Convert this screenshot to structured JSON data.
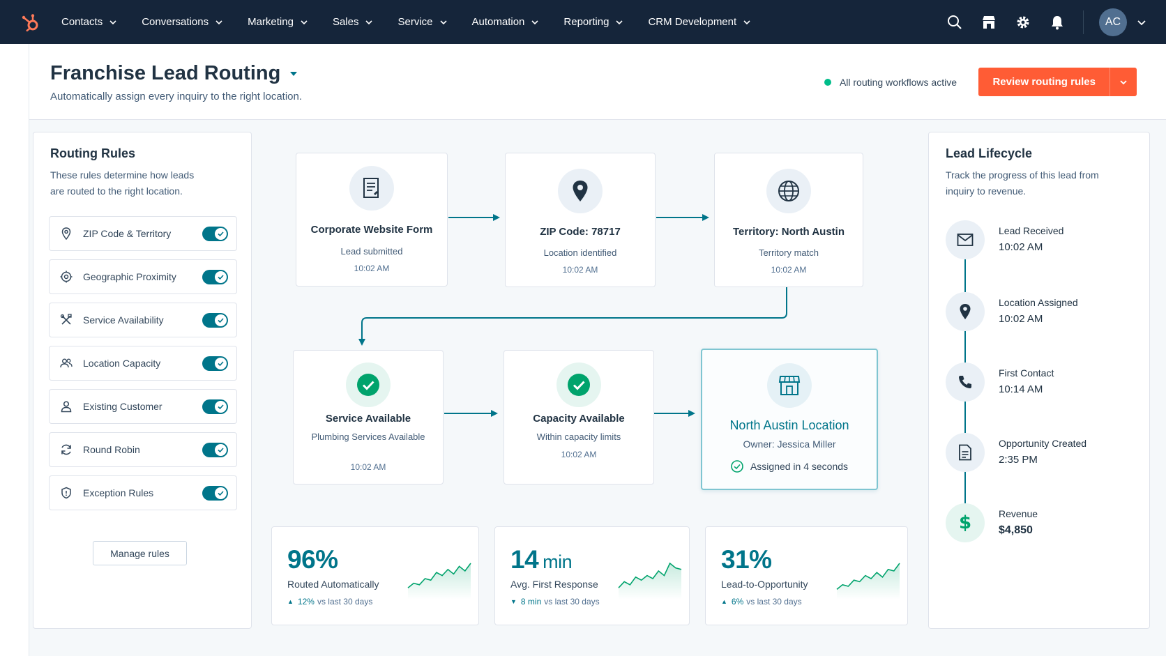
{
  "nav": {
    "items": [
      "Contacts",
      "Conversations",
      "Marketing",
      "Sales",
      "Service",
      "Automation",
      "Reporting",
      "CRM Development"
    ],
    "avatar_initials": "AC"
  },
  "header": {
    "title": "Franchise Lead Routing",
    "subtitle": "Automatically assign every inquiry to the right location.",
    "status": "All routing workflows active",
    "primary_button": "Review routing rules"
  },
  "rules": {
    "title": "Routing Rules",
    "description": "These rules determine how leads are routed to the right location.",
    "items": [
      {
        "label": "ZIP Code & Territory",
        "enabled": true
      },
      {
        "label": "Geographic Proximity",
        "enabled": true
      },
      {
        "label": "Service Availability",
        "enabled": true
      },
      {
        "label": "Location Capacity",
        "enabled": true
      },
      {
        "label": "Existing Customer",
        "enabled": true
      },
      {
        "label": "Round Robin",
        "enabled": true
      },
      {
        "label": "Exception Rules",
        "enabled": true
      }
    ],
    "manage_button": "Manage rules"
  },
  "flow": {
    "step1": {
      "title": "Corporate Website Form",
      "sub": "Lead submitted",
      "time": "10:02 AM"
    },
    "step2": {
      "title": "ZIP Code: 78717",
      "sub": "Location identified",
      "time": "10:02 AM"
    },
    "step3": {
      "title": "Territory: North Austin",
      "sub": "Territory match",
      "time": "10:02 AM"
    },
    "step4": {
      "title": "Service Available",
      "sub": "Plumbing Services Available",
      "time": "10:02 AM"
    },
    "step5": {
      "title": "Capacity Available",
      "sub": "Within capacity limits",
      "time": "10:02 AM"
    },
    "result": {
      "title": "North Austin Location",
      "owner": "Owner: Jessica Miller",
      "assigned": "Assigned in 4 seconds"
    }
  },
  "metrics": [
    {
      "value": "96%",
      "unit": "",
      "label": "Routed Automatically",
      "delta": "12%",
      "delta_suffix": "vs last 30 days",
      "direction": "up",
      "trend": [
        0.2,
        0.35,
        0.3,
        0.5,
        0.45,
        0.7,
        0.6,
        0.8,
        0.65,
        0.9,
        0.75,
        1.0
      ]
    },
    {
      "value": "14",
      "unit": "min",
      "label": "Avg. First Response",
      "delta": "8 min",
      "delta_suffix": "vs last 30 days",
      "direction": "down",
      "trend": [
        0.2,
        0.4,
        0.3,
        0.55,
        0.45,
        0.6,
        0.5,
        0.75,
        0.6,
        1.0,
        0.85,
        0.8
      ]
    },
    {
      "value": "31%",
      "unit": "",
      "label": "Lead-to-Opportunity",
      "delta": "6%",
      "delta_suffix": "vs last 30 days",
      "direction": "up",
      "trend": [
        0.15,
        0.3,
        0.25,
        0.45,
        0.4,
        0.6,
        0.5,
        0.7,
        0.55,
        0.8,
        0.75,
        1.0
      ]
    }
  ],
  "lifecycle": {
    "title": "Lead Lifecycle",
    "description": "Track the progress of this lead from inquiry to revenue.",
    "steps": [
      {
        "label": "Lead Received",
        "value": "10:02 AM",
        "icon": "envelope-icon"
      },
      {
        "label": "Location Assigned",
        "value": "10:02 AM",
        "icon": "map-pin-icon"
      },
      {
        "label": "First Contact",
        "value": "10:14 AM",
        "icon": "phone-icon"
      },
      {
        "label": "Opportunity Created",
        "value": "2:35 PM",
        "icon": "document-icon"
      },
      {
        "label": "Revenue",
        "value": "$4,850",
        "icon": "dollar-icon"
      }
    ]
  },
  "colors": {
    "nav_bg": "#15253a",
    "accent": "#ff5c35",
    "teal": "#00758a",
    "success": "#00bd8a"
  }
}
